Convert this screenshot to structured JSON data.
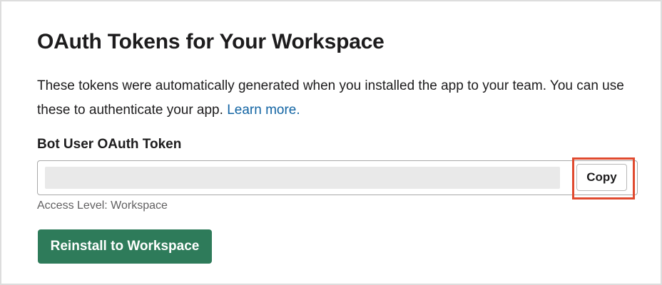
{
  "section": {
    "title": "OAuth Tokens for Your Workspace",
    "description": "These tokens were automatically generated when you installed the app to your team. You can use these to authenticate your app.",
    "learn_more_link": "Learn more."
  },
  "bot_token": {
    "label": "Bot User OAuth Token",
    "value": "",
    "copy_label": "Copy",
    "access_level": "Access Level: Workspace"
  },
  "actions": {
    "reinstall_label": "Reinstall to Workspace"
  },
  "colors": {
    "primary_button": "#2e7b5a",
    "link": "#1264a3",
    "highlight": "#e04a2f"
  }
}
